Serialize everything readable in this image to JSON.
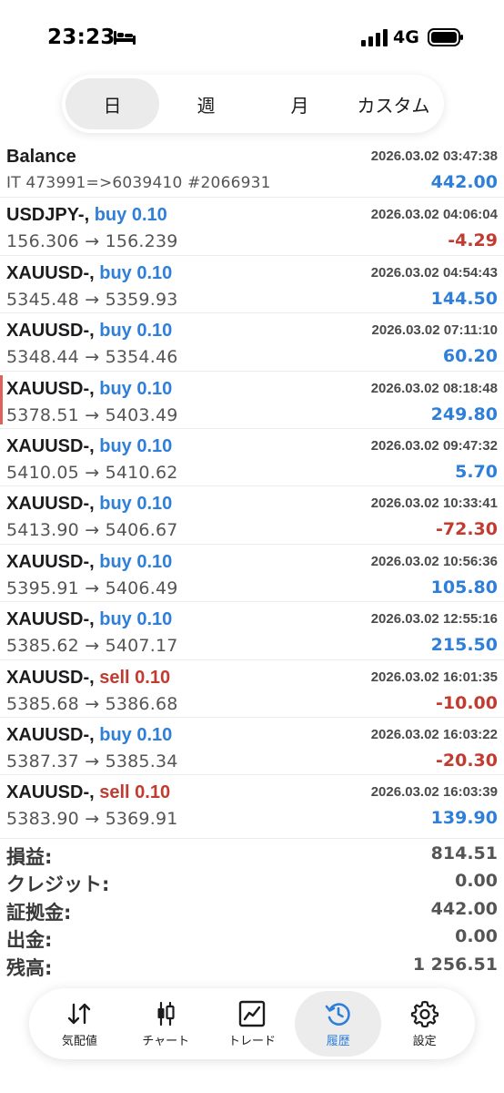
{
  "status": {
    "time": "23:23",
    "network": "4G"
  },
  "tabs": [
    {
      "label": "日",
      "active": true
    },
    {
      "label": "週",
      "active": false
    },
    {
      "label": "月",
      "active": false
    },
    {
      "label": "カスタム",
      "active": false
    }
  ],
  "rows": [
    {
      "symbol": "Balance",
      "side": "",
      "volume": "",
      "time": "2026.03.02 03:47:38",
      "detail": "IT 473991=>6039410 #2066931",
      "amount": "442.00",
      "sign": "pos"
    },
    {
      "symbol": "USDJPY-,",
      "side": "buy",
      "volume": "0.10",
      "time": "2026.03.02 04:06:04",
      "detail": "156.306 → 156.239",
      "amount": "-4.29",
      "sign": "neg"
    },
    {
      "symbol": "XAUUSD-,",
      "side": "buy",
      "volume": "0.10",
      "time": "2026.03.02 04:54:43",
      "detail": "5345.48 → 5359.93",
      "amount": "144.50",
      "sign": "pos"
    },
    {
      "symbol": "XAUUSD-,",
      "side": "buy",
      "volume": "0.10",
      "time": "2026.03.02 07:11:10",
      "detail": "5348.44 → 5354.46",
      "amount": "60.20",
      "sign": "pos"
    },
    {
      "symbol": "XAUUSD-,",
      "side": "buy",
      "volume": "0.10",
      "time": "2026.03.02 08:18:48",
      "detail": "5378.51 → 5403.49",
      "amount": "249.80",
      "sign": "pos"
    },
    {
      "symbol": "XAUUSD-,",
      "side": "buy",
      "volume": "0.10",
      "time": "2026.03.02 09:47:32",
      "detail": "5410.05 → 5410.62",
      "amount": "5.70",
      "sign": "pos"
    },
    {
      "symbol": "XAUUSD-,",
      "side": "buy",
      "volume": "0.10",
      "time": "2026.03.02 10:33:41",
      "detail": "5413.90 → 5406.67",
      "amount": "-72.30",
      "sign": "neg"
    },
    {
      "symbol": "XAUUSD-,",
      "side": "buy",
      "volume": "0.10",
      "time": "2026.03.02 10:56:36",
      "detail": "5395.91 → 5406.49",
      "amount": "105.80",
      "sign": "pos"
    },
    {
      "symbol": "XAUUSD-,",
      "side": "buy",
      "volume": "0.10",
      "time": "2026.03.02 12:55:16",
      "detail": "5385.62 → 5407.17",
      "amount": "215.50",
      "sign": "pos"
    },
    {
      "symbol": "XAUUSD-,",
      "side": "sell",
      "volume": "0.10",
      "time": "2026.03.02 16:01:35",
      "detail": "5385.68 → 5386.68",
      "amount": "-10.00",
      "sign": "neg"
    },
    {
      "symbol": "XAUUSD-,",
      "side": "buy",
      "volume": "0.10",
      "time": "2026.03.02 16:03:22",
      "detail": "5387.37 → 5385.34",
      "amount": "-20.30",
      "sign": "neg"
    },
    {
      "symbol": "XAUUSD-,",
      "side": "sell",
      "volume": "0.10",
      "time": "2026.03.02 16:03:39",
      "detail": "5383.90 → 5369.91",
      "amount": "139.90",
      "sign": "pos"
    }
  ],
  "summary": [
    {
      "label": "損益:",
      "value": "814.51"
    },
    {
      "label": "クレジット:",
      "value": "0.00"
    },
    {
      "label": "証拠金:",
      "value": "442.00"
    },
    {
      "label": "出金:",
      "value": "0.00"
    },
    {
      "label": "残高:",
      "value": "1 256.51"
    }
  ],
  "nav": [
    {
      "label": "気配値",
      "icon": "quotes-arrows-icon",
      "active": false
    },
    {
      "label": "チャート",
      "icon": "candlestick-chart-icon",
      "active": false
    },
    {
      "label": "トレード",
      "icon": "trade-line-chart-icon",
      "active": false
    },
    {
      "label": "履歴",
      "icon": "history-clock-icon",
      "active": true
    },
    {
      "label": "設定",
      "icon": "gear-icon",
      "active": false
    }
  ],
  "colors": {
    "buy": "#2f7fd9",
    "sell": "#c23b30",
    "positive": "#2f7fd9",
    "negative": "#c23b30",
    "accent": "#2f7fd9"
  }
}
